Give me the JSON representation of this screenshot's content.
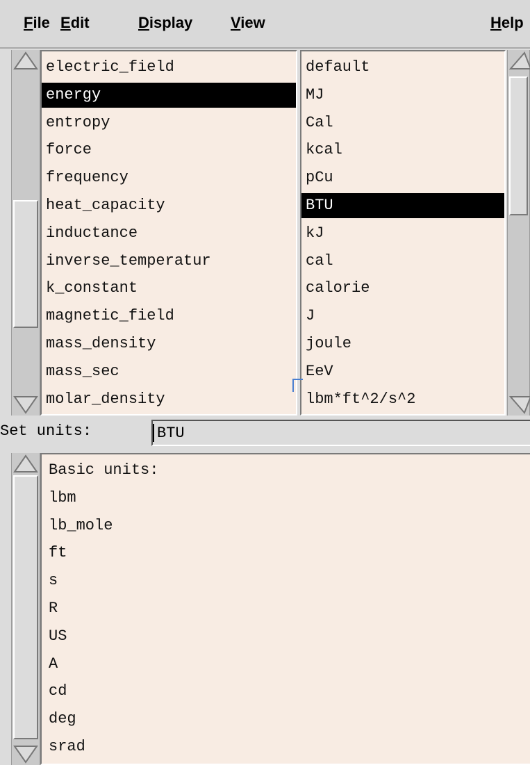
{
  "menubar": {
    "file": {
      "key": "F",
      "rest": "ile"
    },
    "edit": {
      "key": "E",
      "rest": "dit"
    },
    "display": {
      "key": "D",
      "rest": "isplay"
    },
    "view": {
      "key": "V",
      "rest": "iew"
    },
    "help": {
      "key": "H",
      "rest": "elp"
    }
  },
  "quantities": {
    "items": [
      "electric_field",
      "energy",
      "entropy",
      "force",
      "frequency",
      "heat_capacity",
      "inductance",
      "inverse_temperatur",
      "k_constant",
      "magnetic_field",
      "mass_density",
      "mass_sec",
      "molar_density"
    ],
    "selected_index": 1
  },
  "units": {
    "items": [
      "default",
      "MJ",
      "Cal",
      "kcal",
      "pCu",
      "BTU",
      "kJ",
      "cal",
      "calorie",
      "J",
      "joule",
      "EeV",
      "lbm*ft^2/s^2"
    ],
    "selected_index": 5
  },
  "set_units": {
    "label": "Set units:",
    "value": "BTU"
  },
  "basic_units": {
    "items": [
      "Basic units:",
      "lbm",
      "lb_mole",
      "ft",
      "s",
      "R",
      "US",
      "A",
      "cd",
      "deg",
      "srad"
    ]
  }
}
